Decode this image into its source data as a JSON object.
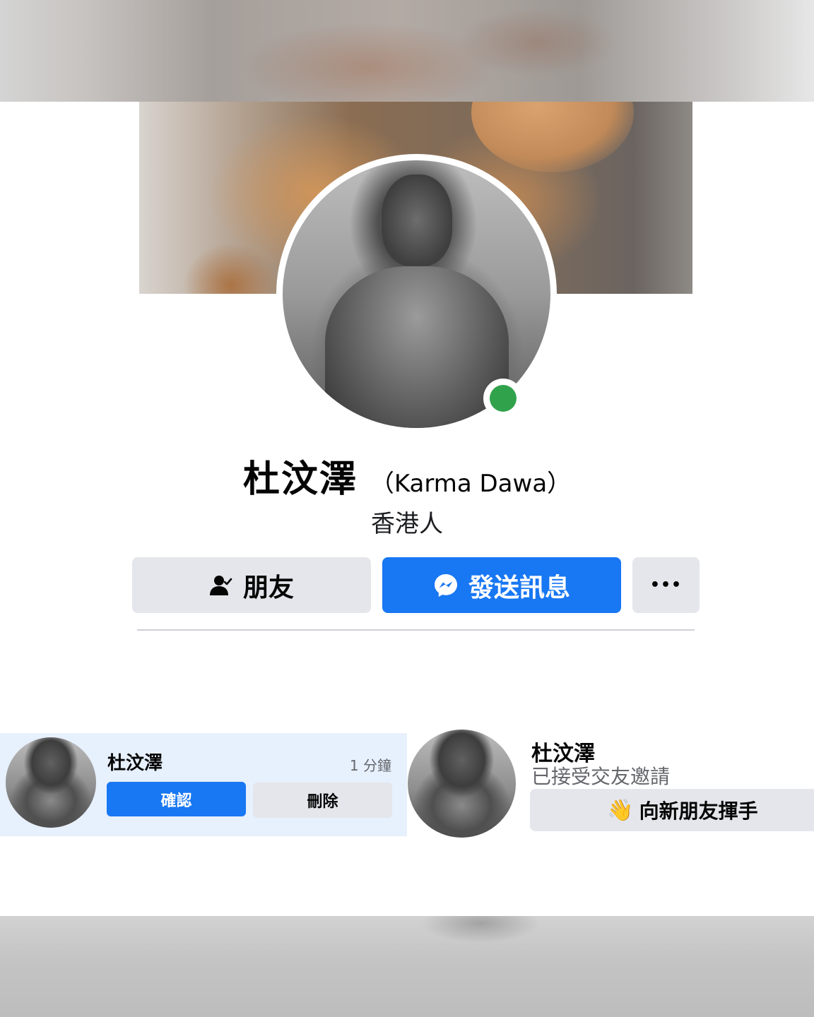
{
  "profile": {
    "name": "杜汶澤",
    "alt_name": "（Karma Dawa）",
    "subtitle": "香港人",
    "online_status_color": "#31a24c"
  },
  "actions": {
    "friends_label": "朋友",
    "friends_icon": "person-check-icon",
    "message_label": "發送訊息",
    "message_icon": "messenger-icon",
    "more_label": "•••",
    "more_icon": "more-dots-icon"
  },
  "friend_request": {
    "name": "杜汶澤",
    "time": "1 分鐘",
    "confirm_label": "確認",
    "delete_label": "刪除"
  },
  "accepted_request": {
    "name": "杜汶澤",
    "status": "已接受交友邀請",
    "wave_icon": "👋",
    "wave_label": "向新朋友揮手"
  },
  "colors": {
    "primary": "#1877f2",
    "secondary_button": "#e4e6eb",
    "notification_bg": "#e7f0fd",
    "muted_text": "#65676b"
  }
}
